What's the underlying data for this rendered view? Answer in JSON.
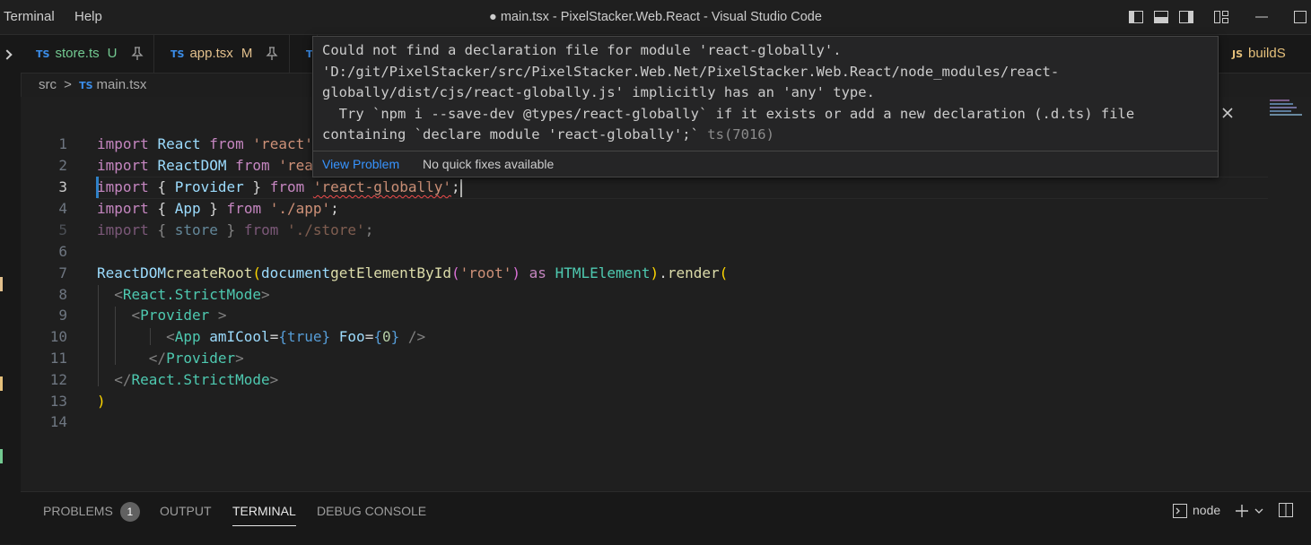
{
  "window": {
    "title": "● main.tsx - PixelStacker.Web.React - Visual Studio Code"
  },
  "menu": [
    "Terminal",
    "Help"
  ],
  "tabs": [
    {
      "badge": "TS",
      "name": "store.ts",
      "status": "U"
    },
    {
      "badge": "TS",
      "name": "app.tsx",
      "status": "M"
    },
    {
      "badge": "T"
    },
    {
      "badge": "JS",
      "name": "buildS"
    }
  ],
  "breadcrumb": {
    "folder": "src",
    "sep": ">",
    "badge": "TS",
    "file": "main.tsx"
  },
  "lines": {
    "n": [
      "1",
      "2",
      "3",
      "4",
      "5",
      "6",
      "7",
      "8",
      "9",
      "10",
      "11",
      "12",
      "13",
      "14"
    ]
  },
  "code": {
    "l1": {
      "a": "import",
      "b": "React",
      "c": "from",
      "d": "'react'"
    },
    "l2": {
      "a": "import",
      "b": "ReactDOM",
      "c": "from",
      "d": "'rea"
    },
    "l3": {
      "a": "import",
      "b": "{",
      "c": "Provider",
      "d": "}",
      "e": "from",
      "f": "'react-g",
      "g": "lobally'",
      "h": ";"
    },
    "l4": {
      "a": "import",
      "b": "{",
      "c": "App",
      "d": "}",
      "e": "from",
      "f": "'./app'",
      "g": ";"
    },
    "l5": {
      "a": "import",
      "b": "{",
      "c": "store",
      "d": "}",
      "e": "from",
      "f": "'./store'",
      "g": ";"
    },
    "l7": {
      "a": "ReactDOM",
      ".": ".",
      "b": "createRoot",
      "c": "(",
      "d": "document",
      "e": "getElementById",
      "f": "(",
      "g": "'root'",
      "h": ")",
      "i": "as",
      "j": "HTMLElement",
      "k": ")",
      "l": ".",
      "m": "render",
      "n": "("
    },
    "l8": {
      "a": "<",
      "b": "React.StrictMode",
      "c": ">"
    },
    "l9": {
      "a": "<",
      "b": "Provider",
      "c": " >"
    },
    "l10": {
      "a": "<",
      "b": "App",
      "c": "amICool",
      "d": "=",
      "e": "{",
      "f": "true",
      "g": "}",
      "h": "Foo",
      "i": "=",
      "j": "{",
      "k": "0",
      "l": "}",
      "m": "/>"
    },
    "l11": {
      "a": "</",
      "b": "Provider",
      "c": ">"
    },
    "l12": {
      "a": "</",
      "b": "React.StrictMode",
      "c": ">"
    },
    "l13": {
      "a": ")"
    }
  },
  "hover": {
    "message": "Could not find a declaration file for module 'react-globally'.\n'D:/git/PixelStacker/src/PixelStacker.Web.Net/PixelStacker.Web.React/node_modules/react-globally/dist/cjs/react-globally.js' implicitly has an 'any' type.\n  Try `npm i --save-dev @types/react-globally` if it exists or add a new declaration (.d.ts) file containing `declare module 'react-globally';`",
    "code": "ts(7016)",
    "view_problem": "View Problem",
    "no_fixes": "No quick fixes available"
  },
  "panel": {
    "tabs": [
      "PROBLEMS",
      "OUTPUT",
      "TERMINAL",
      "DEBUG CONSOLE"
    ],
    "problems_count": "1",
    "terminal_name": "node"
  },
  "colors": {
    "accent": "#3794ff",
    "error": "#f14c4c",
    "ts_badge": "#3b8eea",
    "js_badge": "#e5c07b"
  }
}
